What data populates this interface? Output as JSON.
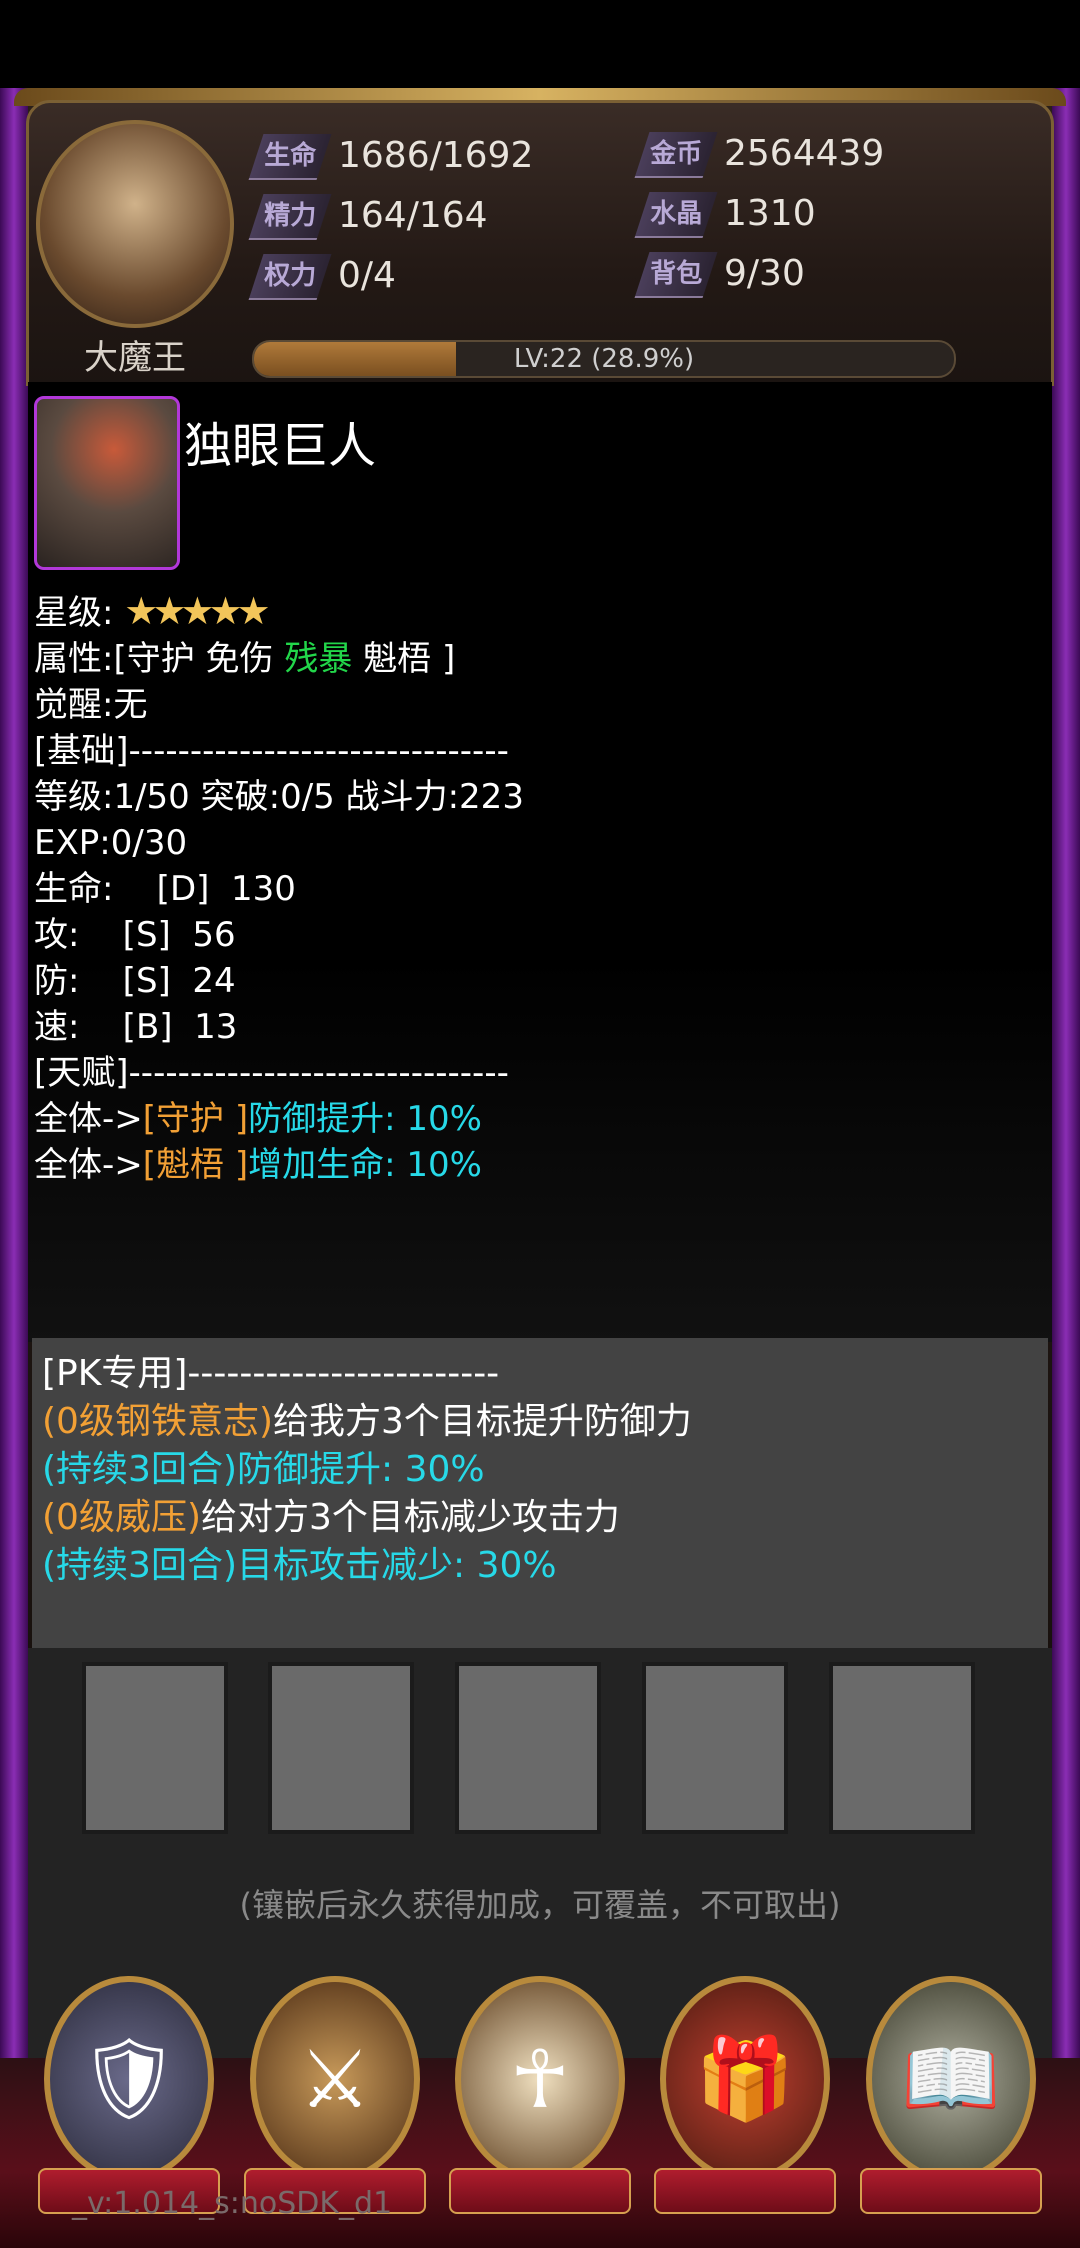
{
  "header": {
    "hero_name": "大魔王",
    "stats": [
      {
        "tag": "生命",
        "value": "1686/1692"
      },
      {
        "tag": "精力",
        "value": "164/164"
      },
      {
        "tag": "权力",
        "value": "0/4"
      },
      {
        "tag": "金币",
        "value": "2564439"
      },
      {
        "tag": "水晶",
        "value": "1310"
      },
      {
        "tag": "背包",
        "value": "9/30"
      }
    ],
    "level_text": "LV:22 (28.9%)",
    "level_progress": 0.289
  },
  "unit": {
    "name": "独眼巨人",
    "star_label": "星级:",
    "stars": "★★★★★",
    "attr_prefix": "属性:[守护 免伤 ",
    "attr_highlight": "残暴",
    "attr_suffix": " 魁梧 ]",
    "awaken": "觉醒:无",
    "basic_header": "[基础]-------------------------------",
    "level_line": "等级:1/50  突破:0/5 战斗力:223",
    "exp_line": "EXP:0/30",
    "hp_line": "生命:    [D]  130",
    "atk_line": "攻:    [S]  56",
    "def_line": "防:    [S]  24",
    "spd_line": "速:    [B]  13",
    "talent_header": "[天赋]-------------------------------",
    "talents": [
      {
        "prefix": "全体->",
        "tag": "[守护 ]",
        "effect": "防御提升: 10%"
      },
      {
        "prefix": "全体->",
        "tag": "[魁梧 ]",
        "effect": "增加生命: 10%"
      }
    ]
  },
  "pk": {
    "header": "[PK专用]------------------------",
    "skill1_name": "(0级钢铁意志)",
    "skill1_desc": "给我方3个目标提升防御力",
    "skill1_effect": "(持续3回合)防御提升: 30%",
    "skill2_name": "(0级威压)",
    "skill2_desc": "给对方3个目标减少攻击力",
    "skill2_effect": "(持续3回合)目标攻击减少: 30%"
  },
  "inlay_hint": "(镶嵌后永久获得加成，可覆盖，不可取出)",
  "nav": [
    {
      "name": "guard-crest",
      "icon": "🛡"
    },
    {
      "name": "helmet-warrior",
      "icon": "⚔"
    },
    {
      "name": "sage-mask",
      "icon": "☥"
    },
    {
      "name": "treasure-chest",
      "icon": "🎁"
    },
    {
      "name": "spell-book",
      "icon": "📖"
    }
  ],
  "version": "_v:1.014_s:noSDK_d1"
}
